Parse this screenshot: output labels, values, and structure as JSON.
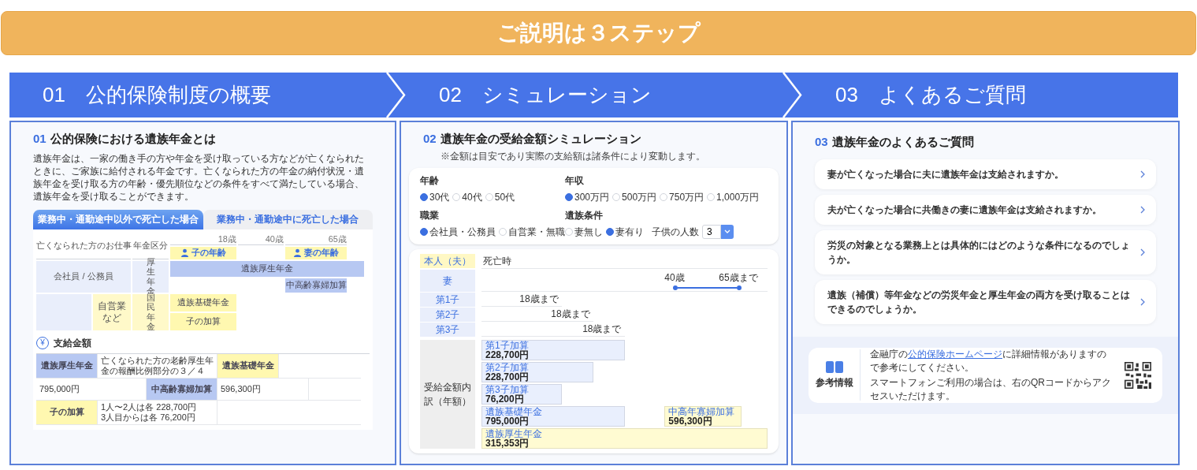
{
  "banner": {
    "title": "ご説明は３ステップ"
  },
  "steps": [
    {
      "number": "01",
      "label": "公的保険制度の概要"
    },
    {
      "number": "02",
      "label": "シミュレーション"
    },
    {
      "number": "03",
      "label": "よくあるご質問"
    }
  ],
  "overview": {
    "number": "01",
    "title": "公的保険における遺族年金とは",
    "description": "遺族年金は、一家の働き手の方や年金を受け取っている方などが亡くなられたときに、ご家族に給付される年金です。亡くなられた方の年金の納付状況・遺族年金を受け取る方の年齢・優先順位などの条件をすべて満たしている場合、遺族年金を受け取ることができます。",
    "tabs": [
      {
        "label": "業務中・通勤途中以外で死亡した場合",
        "selected": true
      },
      {
        "label": "業務中・通勤途中に死亡した場合",
        "selected": false
      }
    ],
    "diagram": {
      "headers": [
        "亡くなられた方のお仕事",
        "年金区分"
      ],
      "ages": [
        "18歳",
        "40歳",
        "65歳"
      ],
      "age_markers": [
        "子の年齢",
        "妻の年齢"
      ],
      "jobs": [
        {
          "label": "会社員 / 公務員",
          "color": "#e9eefb"
        },
        {
          "label": "自営業など",
          "color": "#fff9c9"
        }
      ],
      "categories": [
        {
          "label": "厚生年金",
          "color": "#e9eefb"
        },
        {
          "label": "国民年金",
          "color": "#fff9c9"
        }
      ],
      "benefits": [
        {
          "label": "遺族厚生年金",
          "color": "#b7c8f2"
        },
        {
          "label": "中高齢寡婦加算",
          "color": "#b7c8f2"
        },
        {
          "label": "遺族基礎年金",
          "color": "#fff8b0"
        },
        {
          "label": "子の加算",
          "color": "#fff8b0"
        }
      ]
    },
    "payment": {
      "icon": "¥",
      "title": "支給金額",
      "cells": [
        {
          "text": "遺族厚生年金",
          "color": "#b7c8f2"
        },
        {
          "text": "亡くなられた方の老齢厚生年金の報酬比例部分の３／４"
        },
        {
          "text": "遺族基礎年金",
          "color": "#fff8b0"
        },
        {
          "text": "795,000円"
        },
        {
          "text": "中高齢寡婦加算",
          "color": "#b7c8f2"
        },
        {
          "text": "596,300円"
        },
        {
          "text": "子の加算",
          "color": "#fff8b0"
        },
        {
          "text": "1人〜2人は各 228,700円\n3人目からは各 76,200円"
        }
      ]
    }
  },
  "simulation": {
    "number": "02",
    "title": "遺族年金の受給金額シミュレーション",
    "note": "※金額は目安であり実際の支給額は諸条件により変動します。",
    "form": [
      {
        "label": "年齢",
        "options": [
          {
            "label": "30代",
            "selected": true
          },
          {
            "label": "40代",
            "selected": false
          },
          {
            "label": "50代",
            "selected": false
          }
        ]
      },
      {
        "label": "年収",
        "options": [
          {
            "label": "300万円",
            "selected": true
          },
          {
            "label": "500万円",
            "selected": false
          },
          {
            "label": "750万円",
            "selected": false
          },
          {
            "label": "1,000万円",
            "selected": false
          }
        ]
      },
      {
        "label": "職業",
        "options": [
          {
            "label": "会社員・公務員",
            "selected": true
          },
          {
            "label": "自営業・無職",
            "selected": false
          }
        ]
      },
      {
        "label": "遺族条件",
        "options": [
          {
            "label": "妻無し",
            "selected": false
          },
          {
            "label": "妻有り",
            "selected": true
          }
        ],
        "extra": {
          "label": "子供の人数",
          "value": "3"
        }
      }
    ],
    "timeline": [
      {
        "kind": "event",
        "label": "本人（夫）",
        "color": "#fff8c4",
        "text": "死亡時"
      },
      {
        "kind": "range",
        "label": "妻",
        "color": "#e9eefb",
        "start": "40歳",
        "end": "65歳まで"
      },
      {
        "kind": "until",
        "label": "第1子",
        "color": "#e9eefb",
        "text": "18歳まで"
      },
      {
        "kind": "until",
        "label": "第2子",
        "color": "#e9eefb",
        "text": "18歳まで"
      },
      {
        "kind": "until",
        "label": "第3子",
        "color": "#e9eefb",
        "text": "18歳まで"
      }
    ],
    "breakdown": {
      "label": "受給金額内訳（年額）",
      "items": [
        {
          "name": "第1子加算",
          "amount": "228,700円",
          "color": "#e9effd"
        },
        {
          "name": "第2子加算",
          "amount": "228,700円",
          "color": "#e9effd"
        },
        {
          "name": "第3子加算",
          "amount": "76,200円",
          "color": "#e9effd"
        },
        {
          "name": "遺族基礎年金",
          "amount": "795,000円",
          "color": "#e9effd"
        },
        {
          "name": "中高年寡婦加算",
          "amount": "596,300円",
          "color": "#fffbd2"
        },
        {
          "name": "遺族厚生年金",
          "amount": "315,353円",
          "color": "#fffbd2"
        }
      ]
    }
  },
  "faq": {
    "number": "03",
    "title": "遺族年金のよくあるご質問",
    "questions": [
      "妻が亡くなった場合に夫に遺族年金は支給されますか。",
      "夫が亡くなった場合に共働きの妻に遺族年金は支給されますか。",
      "労災の対象となる業務上とは具体的にはどのような条件になるのでしょうか。",
      "遺族（補償）等年金などの労災年金と厚生年金の両方を受け取ることはできるのでしょうか。"
    ],
    "reference": {
      "label": "参考情報",
      "text_before": "金融庁の",
      "link": "公的保険ホームページ",
      "text_after": "に詳細情報がありますので参考にしてください。",
      "note": "スマートフォンご利用の場合は、右のQRコードからアクセスいただけます。"
    }
  }
}
